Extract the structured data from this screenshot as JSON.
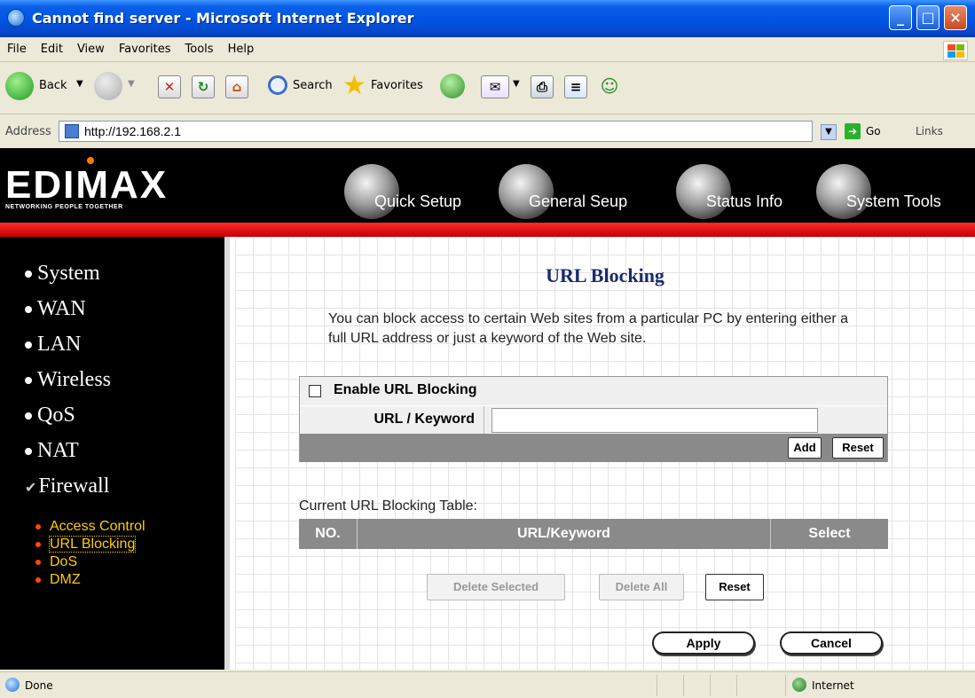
{
  "window": {
    "title": "Cannot find server - Microsoft Internet Explorer",
    "min": "_",
    "max": "□",
    "close": "×"
  },
  "menu": {
    "items": [
      "File",
      "Edit",
      "View",
      "Favorites",
      "Tools",
      "Help"
    ]
  },
  "toolbar": {
    "back": "Back",
    "search": "Search",
    "favorites": "Favorites"
  },
  "address": {
    "label": "Address",
    "url": "http://192.168.2.1",
    "go": "Go",
    "links": "Links"
  },
  "banner": {
    "logo": "EDIMAX",
    "tagline": "NETWORKING PEOPLE TOGETHER",
    "nav": [
      "Quick Setup",
      "General Seup",
      "Status Info",
      "System Tools"
    ]
  },
  "sidebar": {
    "items": [
      "System",
      "WAN",
      "LAN",
      "Wireless",
      "QoS",
      "NAT",
      "Firewall"
    ],
    "firewall_check": "✔",
    "sub_items": [
      "Access Control",
      "URL Blocking",
      "DoS",
      "DMZ"
    ]
  },
  "main": {
    "title": "URL Blocking",
    "description": "You can block access to certain Web sites from a particular PC by entering either a full URL address or just a keyword of the Web site.",
    "enable_label": "Enable URL Blocking",
    "enable_checked": false,
    "url_keyword_label": "URL / Keyword",
    "url_keyword_value": "",
    "add_button": "Add",
    "reset_button": "Reset",
    "table_caption": "Current URL Blocking Table:",
    "table_headers": [
      "NO.",
      "URL/Keyword",
      "Select"
    ],
    "delete_selected": "Delete Selected",
    "delete_all": "Delete All",
    "table_reset": "Reset",
    "apply": "Apply",
    "cancel": "Cancel"
  },
  "status": {
    "text": "Done",
    "zone": "Internet"
  },
  "colors": {
    "title_blue": "#0054e3",
    "banner_black": "#000000",
    "red_bar": "#e00000",
    "submenu_yellow": "#ffcc00",
    "header_gray": "#8a8a8a"
  }
}
